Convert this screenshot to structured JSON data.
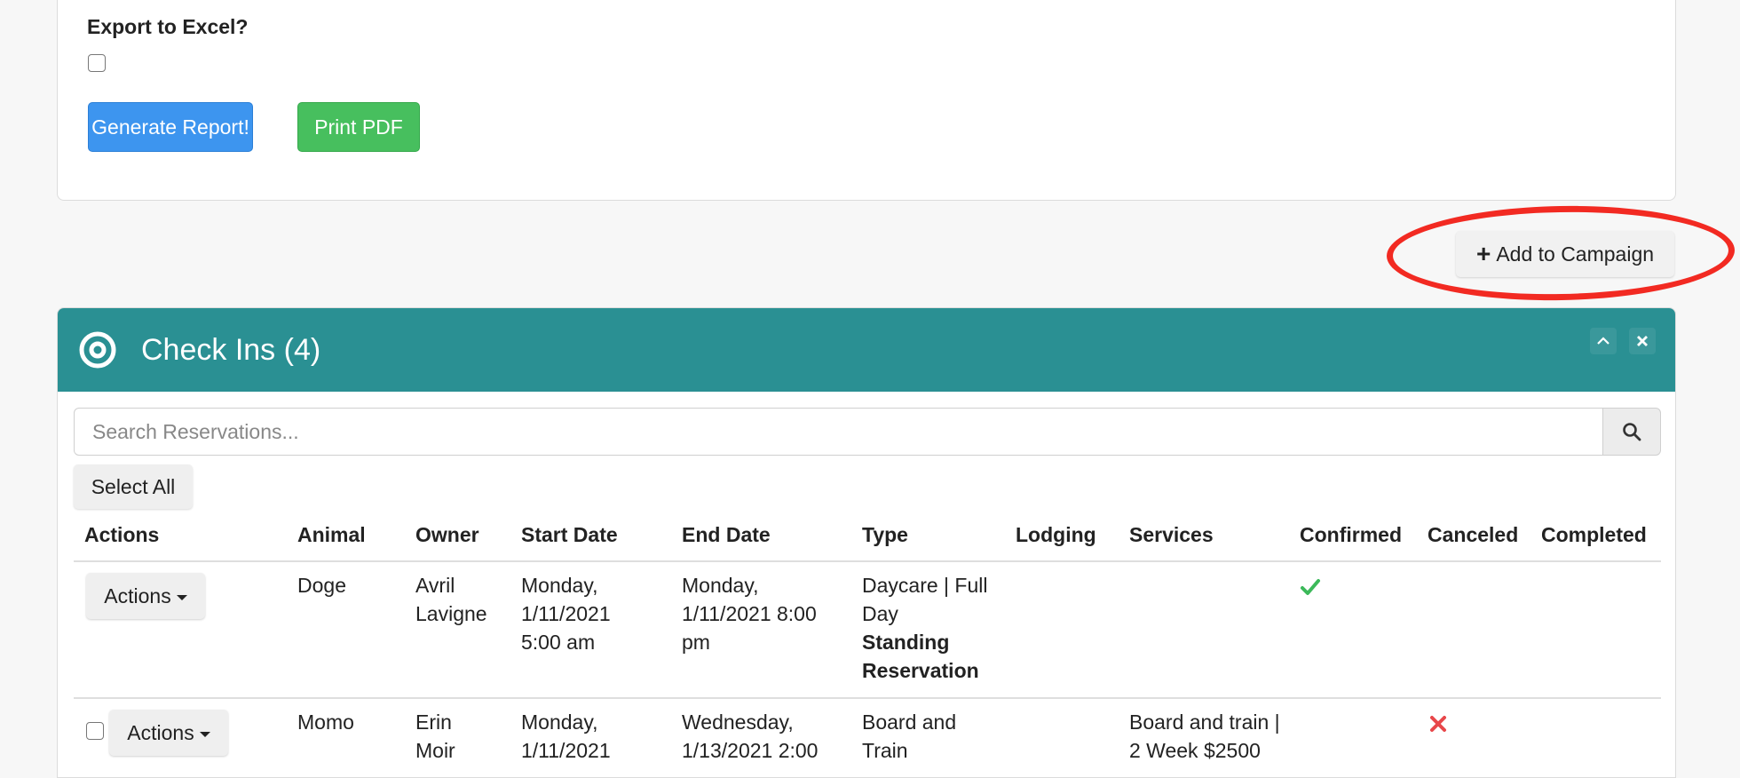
{
  "report": {
    "export_label": "Export to Excel?",
    "generate_label": "Generate Report!",
    "print_label": "Print PDF"
  },
  "campaign": {
    "label": "Add to Campaign",
    "icon": "plus-icon"
  },
  "checkins": {
    "title": "Check Ins (4)",
    "search_placeholder": "Search Reservations...",
    "select_all_label": "Select All",
    "columns": [
      "Actions",
      "Animal",
      "Owner",
      "Start Date",
      "End Date",
      "Type",
      "Lodging",
      "Services",
      "Confirmed",
      "Canceled",
      "Completed"
    ],
    "rows": [
      {
        "actions_label": "Actions",
        "animal": "Doge",
        "owner": "Avril Lavigne",
        "start_date": "Monday, 1/11/2021 5:00 am",
        "end_date": "Monday, 1/11/2021 8:00 pm",
        "type": "Daycare | Full Day",
        "type_sub": "Standing Reservation",
        "lodging": "",
        "services": "",
        "confirmed": true,
        "canceled": false
      },
      {
        "actions_label": "Actions",
        "animal": "Momo",
        "owner": "Erin Moir",
        "start_date": "Monday, 1/11/2021",
        "end_date": "Wednesday, 1/13/2021 2:00",
        "type": "Board and Train",
        "type_sub": "",
        "lodging": "",
        "services": "Board and train | 2 Week $2500",
        "confirmed": false,
        "canceled": true
      }
    ]
  },
  "colors": {
    "header_bg": "#2a9093",
    "primary": "#3d95ef",
    "success": "#47bf5e",
    "confirm_check": "#3cb95a",
    "cancel_cross": "#e8474a",
    "highlight": "#f22a22"
  }
}
